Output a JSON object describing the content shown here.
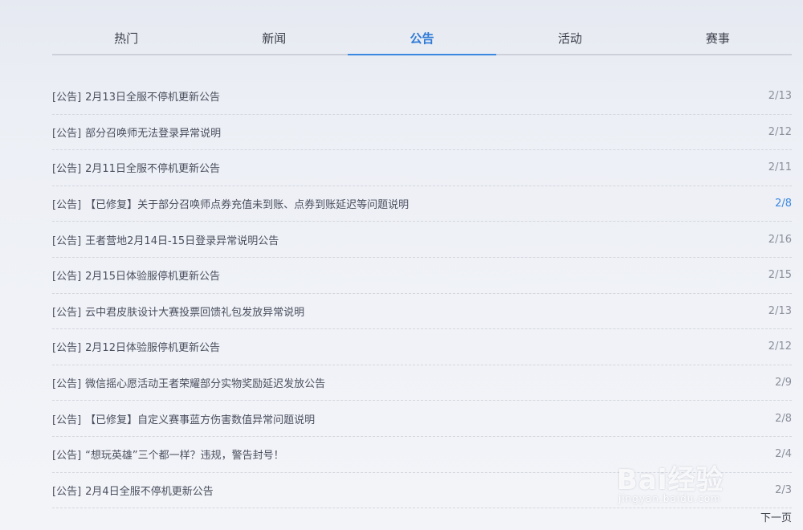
{
  "tabs": [
    {
      "label": "热门"
    },
    {
      "label": "新闻"
    },
    {
      "label": "公告"
    },
    {
      "label": "活动"
    },
    {
      "label": "赛事"
    }
  ],
  "active_tab": "公告",
  "items": [
    {
      "tag": "[公告]",
      "title": "2月13日全服不停机更新公告",
      "date": "2/13"
    },
    {
      "tag": "[公告]",
      "title": "部分召唤师无法登录异常说明",
      "date": "2/12"
    },
    {
      "tag": "[公告]",
      "title": "2月11日全服不停机更新公告",
      "date": "2/11"
    },
    {
      "tag": "[公告]",
      "title": "【已修复】关于部分召唤师点券充值未到账、点券到账延迟等问题说明",
      "date": "2/8"
    },
    {
      "tag": "[公告]",
      "title": "王者营地2月14日-15日登录异常说明公告",
      "date": "2/16"
    },
    {
      "tag": "[公告]",
      "title": "2月15日体验服停机更新公告",
      "date": "2/15"
    },
    {
      "tag": "[公告]",
      "title": "云中君皮肤设计大赛投票回馈礼包发放异常说明",
      "date": "2/13"
    },
    {
      "tag": "[公告]",
      "title": "2月12日体验服停机更新公告",
      "date": "2/12"
    },
    {
      "tag": "[公告]",
      "title": "微信摇心愿活动王者荣耀部分实物奖励延迟发放公告",
      "date": "2/9"
    },
    {
      "tag": "[公告]",
      "title": "【已修复】自定义赛事蓝方伤害数值异常问题说明",
      "date": "2/8"
    },
    {
      "tag": "[公告]",
      "title": "“想玩英雄”三个都一样？违规，警告封号！",
      "date": "2/4"
    },
    {
      "tag": "[公告]",
      "title": "2月4日全服不停机更新公告",
      "date": "2/3"
    }
  ],
  "next_label": "下一页",
  "watermark": {
    "logo": "Bai经验",
    "url": "jingyan.baidu.com"
  },
  "colors": {
    "accent": "#3a88e0",
    "text": "#4a4f5e",
    "date": "#8a8f9b"
  }
}
